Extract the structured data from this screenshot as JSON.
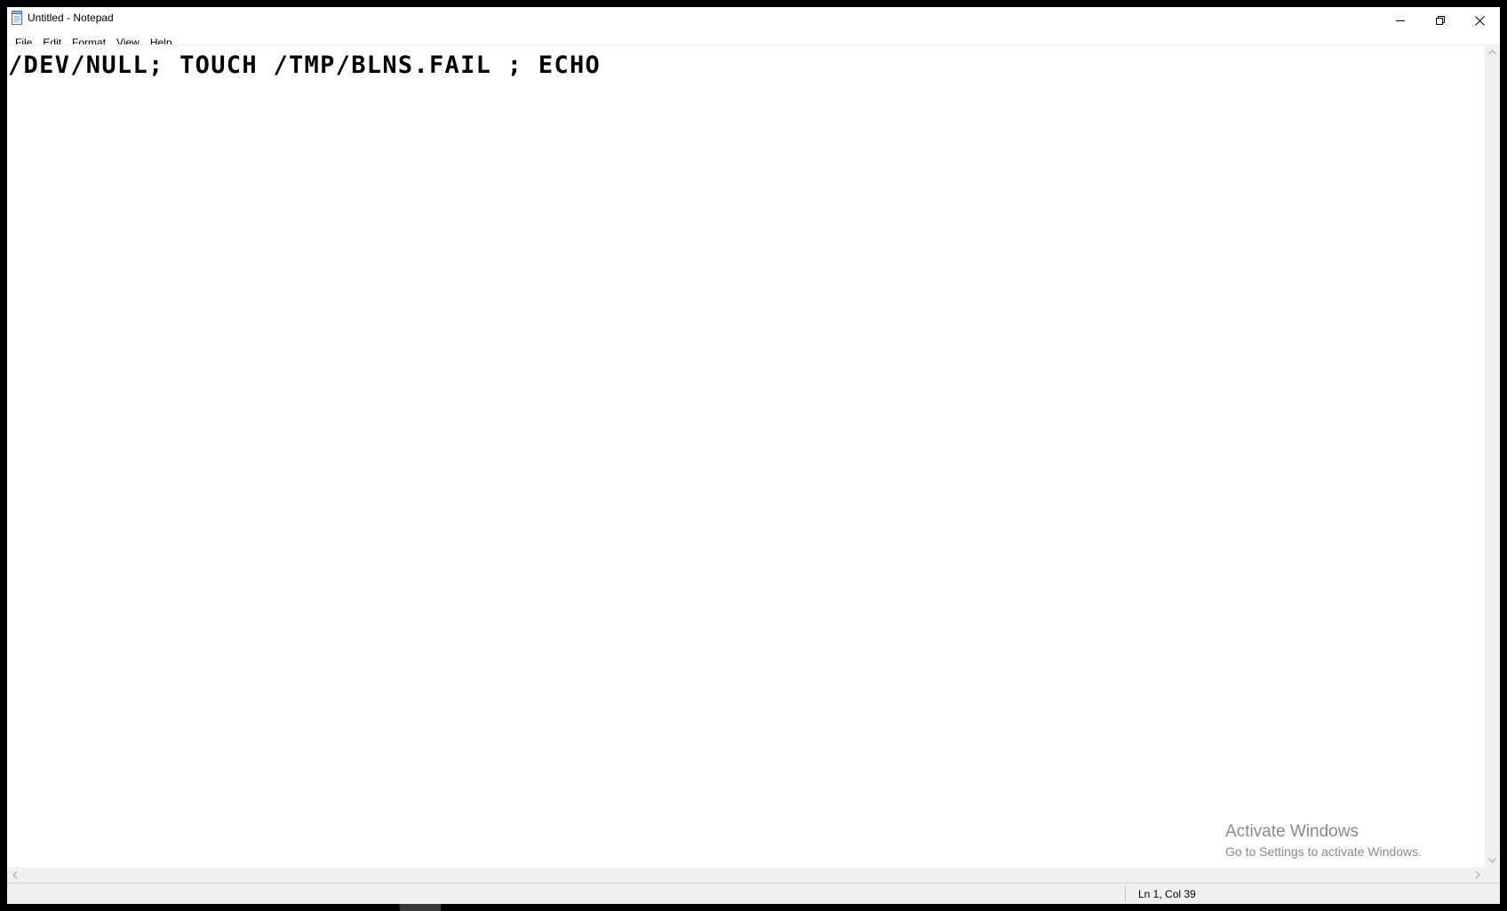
{
  "window": {
    "title": "Untitled - Notepad",
    "app_icon": "notepad-icon",
    "controls": {
      "minimize": "minimize-icon",
      "maximize": "restore-icon",
      "close": "close-icon"
    }
  },
  "menubar": {
    "items": [
      {
        "label": "File"
      },
      {
        "label": "Edit"
      },
      {
        "label": "Format"
      },
      {
        "label": "View"
      },
      {
        "label": "Help"
      }
    ]
  },
  "editor": {
    "content": "/DEV/NULL; TOUCH /TMP/BLNS.FAIL ; ECHO"
  },
  "statusbar": {
    "position": "Ln 1, Col 39"
  },
  "watermark": {
    "title": "Activate Windows",
    "subtitle": "Go to Settings to activate Windows."
  },
  "colors": {
    "background": "#ffffff",
    "chrome": "#f0f0f0",
    "watermark": "#8a8a8a",
    "frame": "#000000"
  }
}
